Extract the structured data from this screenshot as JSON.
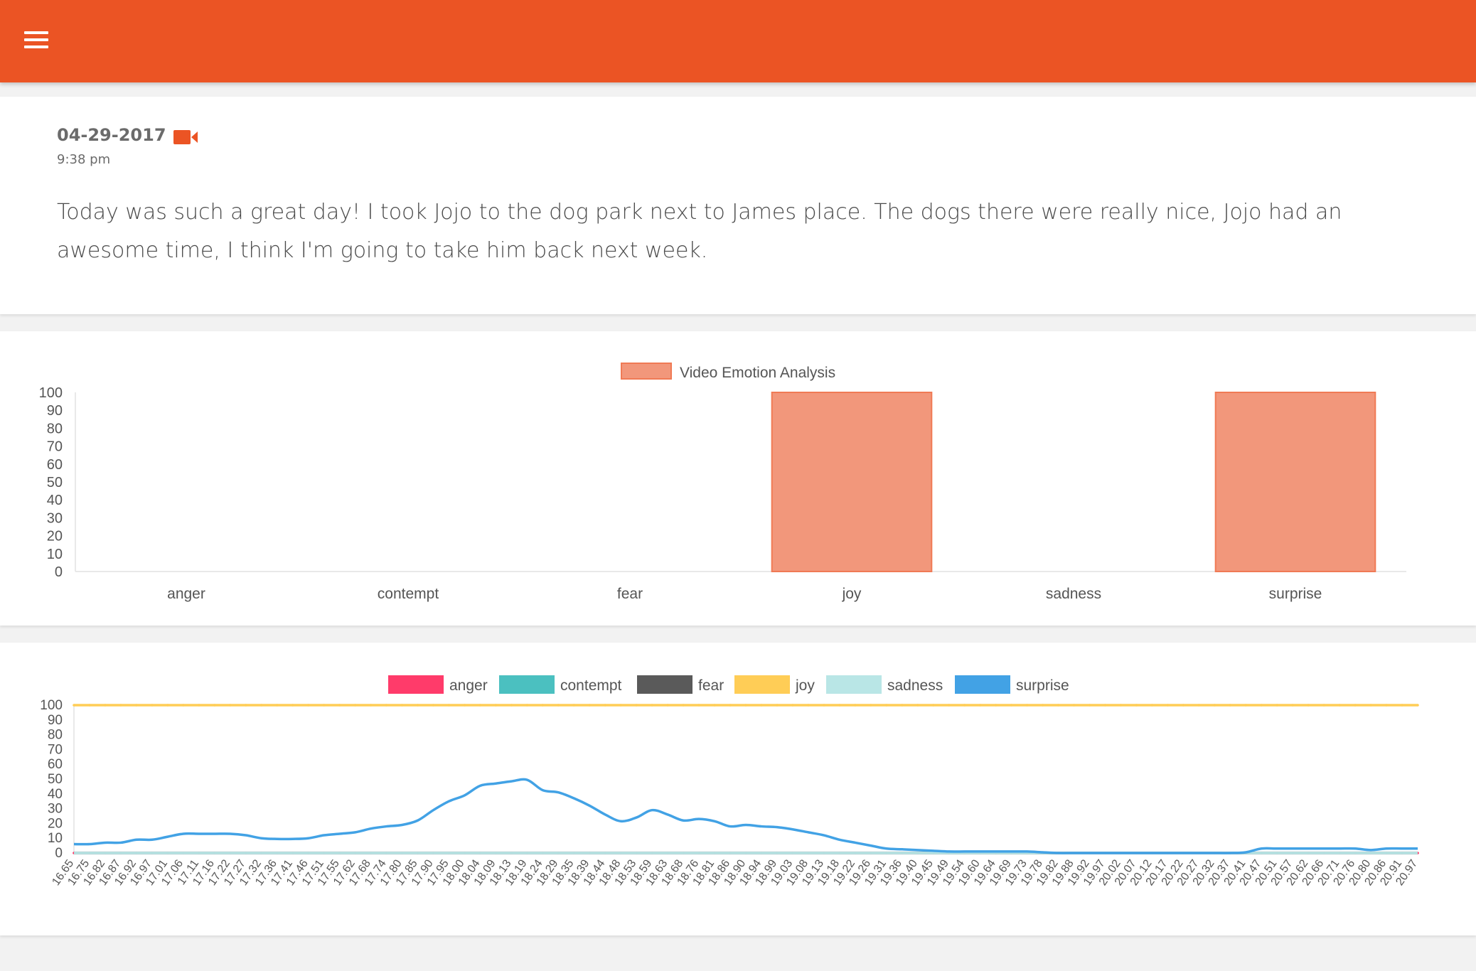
{
  "header": {
    "menu_icon": "hamburger-menu-icon",
    "color": "#eb5424"
  },
  "entry": {
    "date": "04-29-2017",
    "time": "9:38 pm",
    "media_icon": "video-camera-icon",
    "text": "Today was such a great day! I took Jojo to the dog park next to James place. The dogs there were really nice, Jojo had an awesome time, I think I'm going to take him back next week."
  },
  "chart_data": [
    {
      "type": "bar",
      "categories": [
        "anger",
        "contempt",
        "fear",
        "joy",
        "sadness",
        "surprise"
      ],
      "series": [
        {
          "name": "Video Emotion Analysis",
          "values": [
            0,
            0,
            0,
            100,
            0,
            100
          ],
          "color": "#f2977b"
        }
      ],
      "ylim": [
        0,
        100
      ],
      "yticks": [
        0,
        10,
        20,
        30,
        40,
        50,
        60,
        70,
        80,
        90,
        100
      ],
      "legend_position": "top"
    },
    {
      "type": "line",
      "x": [
        "16.65",
        "16.75",
        "16.82",
        "16.87",
        "16.92",
        "16.97",
        "17.01",
        "17.06",
        "17.11",
        "17.16",
        "17.22",
        "17.27",
        "17.32",
        "17.36",
        "17.41",
        "17.46",
        "17.51",
        "17.55",
        "17.62",
        "17.68",
        "17.74",
        "17.80",
        "17.85",
        "17.90",
        "17.95",
        "18.00",
        "18.04",
        "18.09",
        "18.13",
        "18.19",
        "18.24",
        "18.29",
        "18.35",
        "18.39",
        "18.44",
        "18.48",
        "18.53",
        "18.59",
        "18.63",
        "18.68",
        "18.76",
        "18.81",
        "18.86",
        "18.90",
        "18.94",
        "18.99",
        "19.03",
        "19.08",
        "19.13",
        "19.18",
        "19.22",
        "19.26",
        "19.31",
        "19.36",
        "19.40",
        "19.45",
        "19.49",
        "19.54",
        "19.60",
        "19.64",
        "19.69",
        "19.73",
        "19.78",
        "19.82",
        "19.88",
        "19.92",
        "19.97",
        "20.02",
        "20.07",
        "20.12",
        "20.17",
        "20.22",
        "20.27",
        "20.32",
        "20.37",
        "20.41",
        "20.47",
        "20.51",
        "20.57",
        "20.62",
        "20.66",
        "20.71",
        "20.76",
        "20.80",
        "20.86",
        "20.91",
        "20.97"
      ],
      "series": [
        {
          "name": "anger",
          "color": "#ff3b6a",
          "values": [
            0,
            0,
            0,
            0,
            0,
            0,
            0,
            0,
            0,
            0,
            0,
            0,
            0,
            0,
            0,
            0,
            0,
            0,
            0,
            0,
            0,
            0,
            0,
            0,
            0,
            0,
            0,
            0,
            0,
            0,
            0,
            0,
            0,
            0,
            0,
            0,
            0,
            0,
            0,
            0,
            0,
            0,
            0,
            0,
            0,
            0,
            0,
            0,
            0,
            0,
            0,
            0,
            0,
            0,
            0,
            0,
            0,
            0,
            0,
            0,
            0,
            0,
            0,
            0,
            0,
            0,
            0,
            0,
            0,
            0,
            0,
            0,
            0,
            0,
            0,
            0,
            0,
            0,
            0,
            0,
            0,
            0,
            0,
            0,
            0,
            0,
            0
          ]
        },
        {
          "name": "contempt",
          "color": "#4bc0c0",
          "values": [
            0,
            0,
            0,
            0,
            0,
            0,
            0,
            0,
            0,
            0,
            0,
            0,
            0,
            0,
            0,
            0,
            0,
            0,
            0,
            0,
            0,
            0,
            0,
            0,
            0,
            0,
            0,
            0,
            0,
            0,
            0,
            0,
            0,
            0,
            0,
            0,
            0,
            0,
            0,
            0,
            0,
            0,
            0,
            0,
            0,
            0,
            0,
            0,
            0,
            0,
            0,
            0,
            0,
            0,
            0,
            0,
            0,
            0,
            0,
            0,
            0,
            0,
            0,
            0,
            0,
            0,
            0,
            0,
            0,
            0,
            0,
            0,
            0,
            0,
            0,
            0,
            0,
            0,
            0,
            0,
            0,
            0,
            0,
            0,
            0,
            0,
            0
          ]
        },
        {
          "name": "fear",
          "color": "#5a5a5a",
          "values": [
            0,
            0,
            0,
            0,
            0,
            0,
            0,
            0,
            0,
            0,
            0,
            0,
            0,
            0,
            0,
            0,
            0,
            0,
            0,
            0,
            0,
            0,
            0,
            0,
            0,
            0,
            0,
            0,
            0,
            0,
            0,
            0,
            0,
            0,
            0,
            0,
            0,
            0,
            0,
            0,
            0,
            0,
            0,
            0,
            0,
            0,
            0,
            0,
            0,
            0,
            0,
            0,
            0,
            0,
            0,
            0,
            0,
            0,
            0,
            0,
            0,
            0,
            0,
            0,
            0,
            0,
            0,
            0,
            0,
            0,
            0,
            0,
            0,
            0,
            0,
            0,
            0,
            0,
            0,
            0,
            0,
            0,
            0,
            0,
            0,
            0,
            0
          ]
        },
        {
          "name": "joy",
          "color": "#ffcd56",
          "values": [
            100,
            100,
            100,
            100,
            100,
            100,
            100,
            100,
            100,
            100,
            100,
            100,
            100,
            100,
            100,
            100,
            100,
            100,
            100,
            100,
            100,
            100,
            100,
            100,
            100,
            100,
            100,
            100,
            100,
            100,
            100,
            100,
            100,
            100,
            100,
            100,
            100,
            100,
            100,
            100,
            100,
            100,
            100,
            100,
            100,
            100,
            100,
            100,
            100,
            100,
            100,
            100,
            100,
            100,
            100,
            100,
            100,
            100,
            100,
            100,
            100,
            100,
            100,
            100,
            100,
            100,
            100,
            100,
            100,
            100,
            100,
            100,
            100,
            100,
            100,
            100,
            100,
            100,
            100,
            100,
            100,
            100,
            100,
            100,
            100,
            100,
            100
          ]
        },
        {
          "name": "sadness",
          "color": "#b9e6e6",
          "values": [
            0,
            0,
            0,
            0,
            0,
            0,
            0,
            0,
            0,
            0,
            0,
            0,
            0,
            0,
            0,
            0,
            0,
            0,
            0,
            0,
            0,
            0,
            0,
            0,
            0,
            0,
            0,
            0,
            0,
            0,
            0,
            0,
            0,
            0,
            0,
            0,
            0,
            0,
            0,
            0,
            0,
            0,
            0,
            0,
            0,
            0,
            0,
            0,
            0,
            0,
            0,
            0,
            0,
            0,
            0,
            0,
            0,
            0,
            0,
            0,
            0,
            0,
            0,
            0,
            0,
            0,
            0,
            0,
            0,
            0,
            0,
            0,
            0,
            0,
            0,
            0,
            0,
            0,
            0,
            0,
            0,
            0,
            0,
            0,
            0,
            0,
            0
          ]
        },
        {
          "name": "surprise",
          "color": "#42a2e5",
          "values": [
            6,
            6,
            7,
            7,
            9,
            9,
            11,
            13,
            13,
            13,
            13,
            12,
            10,
            9.5,
            9.5,
            10,
            12,
            13,
            14,
            16.5,
            18,
            19,
            22,
            29,
            35,
            39,
            45.5,
            47,
            48.5,
            49.5,
            42.5,
            41,
            37,
            32,
            26,
            21.5,
            24,
            29,
            26,
            22,
            23,
            21.5,
            18,
            19,
            18,
            17.5,
            16,
            14,
            12,
            9,
            7,
            5,
            3,
            2.5,
            2,
            1.5,
            1,
            1,
            1,
            1,
            1,
            1,
            0.5,
            0,
            0,
            0,
            0,
            0,
            0,
            0,
            0,
            0,
            0,
            0,
            0,
            0.5,
            3,
            3,
            3,
            3,
            3,
            3,
            3,
            2,
            3,
            3,
            3
          ]
        }
      ],
      "ylim": [
        0,
        100
      ],
      "yticks": [
        0,
        10,
        20,
        30,
        40,
        50,
        60,
        70,
        80,
        90,
        100
      ],
      "legend_position": "top"
    }
  ]
}
